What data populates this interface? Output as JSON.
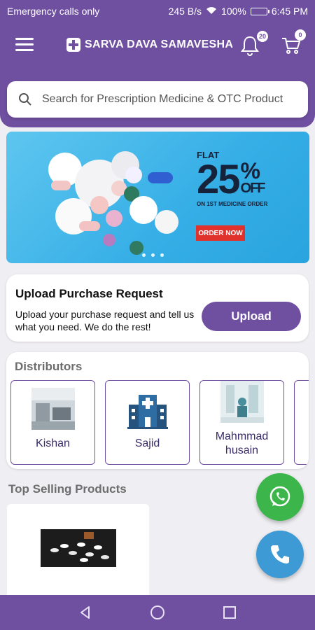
{
  "status_bar": {
    "carrier": "Emergency calls only",
    "speed": "245 B/s",
    "battery": "100%",
    "time": "6:45 PM"
  },
  "header": {
    "app_name": "SARVA DAVA SAMAVESHA",
    "notification_count": "20",
    "cart_count": "0"
  },
  "search": {
    "placeholder": "Search for Prescription Medicine & OTC Product"
  },
  "banner": {
    "flat": "FLAT",
    "percent": "25",
    "pct_sign": "%",
    "off": "OFF",
    "subtext": "ON 1ST MEDICINE ORDER",
    "cta": "ORDER NOW"
  },
  "upload": {
    "title": "Upload Purchase Request",
    "description": "Upload your purchase request and tell us what you need. We do the rest!",
    "button": "Upload"
  },
  "distributors": {
    "title": "Distributors",
    "items": [
      {
        "name": "Kishan"
      },
      {
        "name": "Sajid"
      },
      {
        "name": "Mahmmad husain"
      }
    ]
  },
  "top_selling": {
    "title": "Top Selling Products"
  },
  "colors": {
    "primary": "#6f4fa0",
    "whatsapp": "#3cb54a",
    "call": "#3d9ad4",
    "order_now": "#e0312b"
  },
  "icons": [
    "menu-icon",
    "bell-icon",
    "cart-icon",
    "search-icon",
    "hospital-icon",
    "whatsapp-icon",
    "phone-icon",
    "back-icon",
    "home-icon",
    "recents-icon"
  ]
}
